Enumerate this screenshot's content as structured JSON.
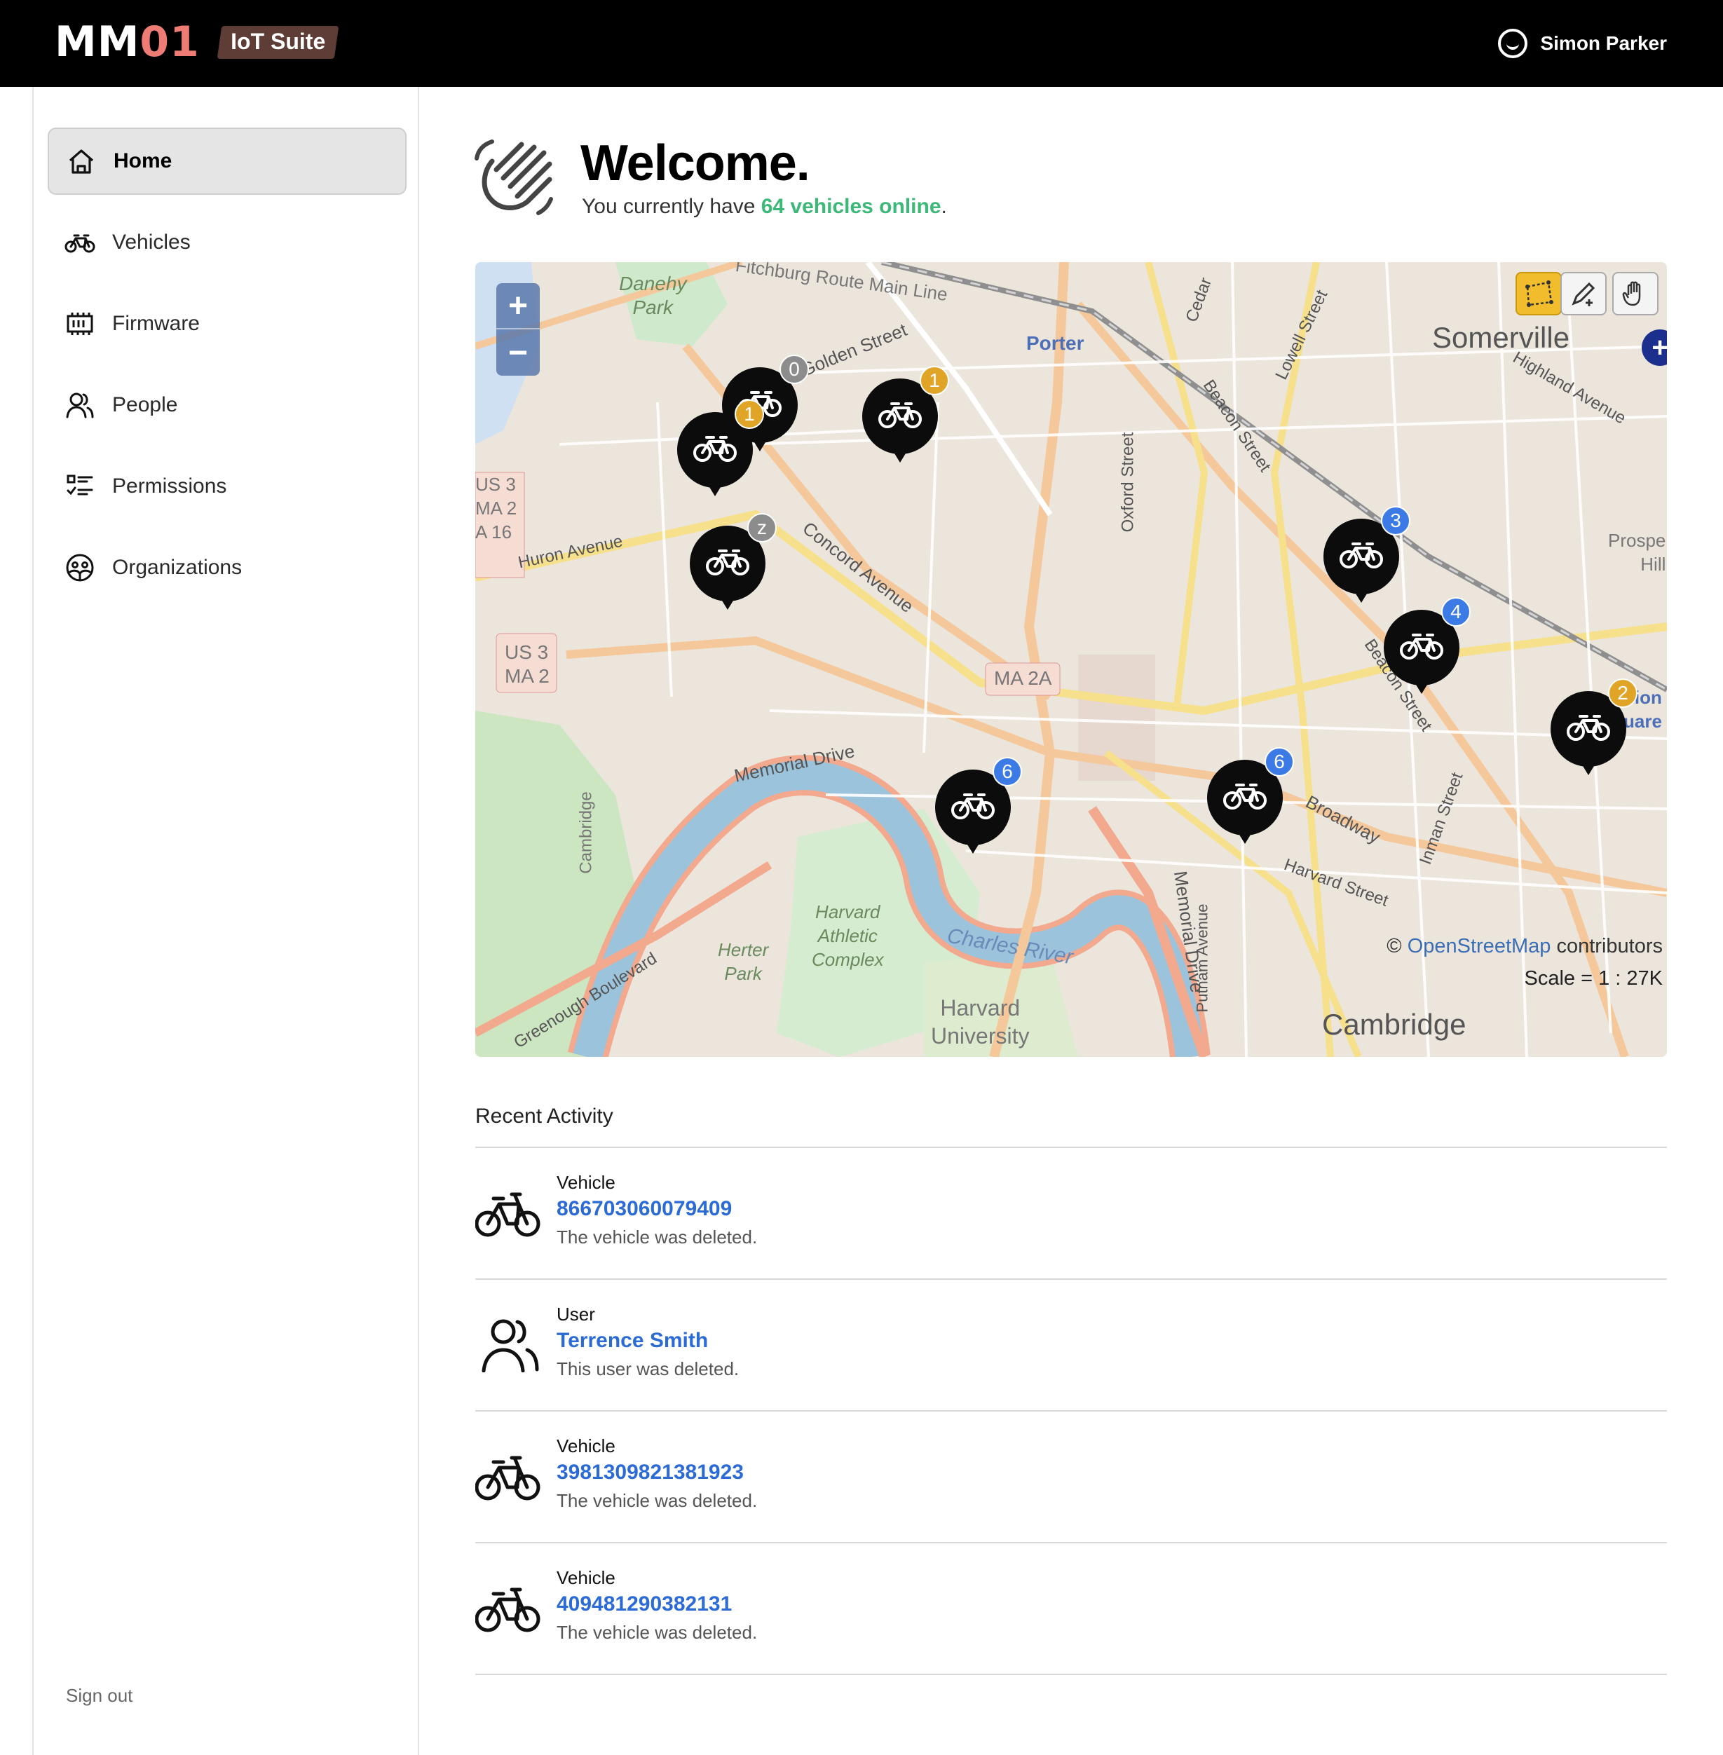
{
  "brand": {
    "mm": "MM",
    "num": "01",
    "tag": "IoT Suite"
  },
  "user": {
    "name": "Simon Parker"
  },
  "sidebar": {
    "items": [
      {
        "label": "Home",
        "icon": "home-icon",
        "active": true
      },
      {
        "label": "Vehicles",
        "icon": "bike-icon"
      },
      {
        "label": "Firmware",
        "icon": "chip-icon"
      },
      {
        "label": "People",
        "icon": "people-icon"
      },
      {
        "label": "Permissions",
        "icon": "checklist-icon"
      },
      {
        "label": "Organizations",
        "icon": "organization-icon"
      }
    ],
    "signout": "Sign out"
  },
  "welcome": {
    "title": "Welcome.",
    "prefix": "You currently have ",
    "highlight": "64 vehicles online",
    "suffix": "."
  },
  "map": {
    "zoom_in": "+",
    "zoom_out": "−",
    "labels": {
      "danehy": "Danehy",
      "park": "Park",
      "route": "Fitchburg Route Main Line",
      "golden": "Golden Street",
      "porter": "Porter",
      "somerville": "Somerville",
      "highland": "Highland Avenue",
      "cedar": "Cedar",
      "lowell": "Lowell Street",
      "oxford": "Oxford Street",
      "beacon1": "Beacon Street",
      "beacon2": "Beacon Street",
      "huron": "Huron Avenue",
      "concord": "Concord Avenue",
      "us3a": "US 3",
      "ma2a": "MA 2",
      "ma16": "A 16",
      "us3b": "US 3",
      "ma2b": "MA 2",
      "ma2x": "MA 2A",
      "memorial": "Memorial Drive",
      "memorial2": "Memorial Drive",
      "broadway": "Broadway",
      "harvard": "Harvard Street",
      "inman": "Inman Street",
      "prospect": "Prospe",
      "hill": "Hill",
      "charles": "Charles River",
      "athletic1": "Harvard",
      "athletic2": "Athletic",
      "athletic3": "Complex",
      "herter1": "Herter",
      "herter2": "Park",
      "harvu1": "Harvard",
      "harvu2": "University",
      "cambridge": "Cambridge",
      "putnam": "Putnam Avenue",
      "greenough": "Greenough Boulevard",
      "cambridgevert": "Cambridge",
      "union": "nion",
      "square": "uare"
    },
    "attribution_prefix": "© ",
    "attribution_link": "OpenStreetMap",
    "attribution_suffix": " contributors",
    "scale": "Scale = 1 : 27K",
    "markers": [
      {
        "badge": "0",
        "badge_color": "#8c8c8c"
      },
      {
        "badge": "1",
        "badge_color": "#e0a526"
      },
      {
        "badge": "1",
        "badge_color": "#e0a526"
      },
      {
        "badge": "z",
        "badge_color": "#8c8c8c"
      },
      {
        "badge": "3",
        "badge_color": "#3c7be6"
      },
      {
        "badge": "4",
        "badge_color": "#3c7be6"
      },
      {
        "badge": "2",
        "badge_color": "#e0a526"
      },
      {
        "badge": "6",
        "badge_color": "#3c7be6"
      },
      {
        "badge": "6",
        "badge_color": "#3c7be6"
      }
    ],
    "tools": [
      "polygon-select-icon",
      "edit-icon",
      "hand-pan-icon"
    ]
  },
  "recent_activity": {
    "title": "Recent Activity",
    "items": [
      {
        "type": "Vehicle",
        "link": "866703060079409",
        "desc": "The vehicle was deleted.",
        "icon": "bike-icon"
      },
      {
        "type": "User",
        "link": "Terrence Smith",
        "desc": "This user was deleted.",
        "icon": "people-icon"
      },
      {
        "type": "Vehicle",
        "link": "3981309821381923",
        "desc": "The vehicle was deleted.",
        "icon": "bike-icon"
      },
      {
        "type": "Vehicle",
        "link": "409481290382131",
        "desc": "The vehicle was deleted.",
        "icon": "bike-icon"
      }
    ]
  },
  "colors": {
    "accent_green": "#3cb878",
    "link_blue": "#2c6bd6",
    "brand_red": "#ee7c74",
    "badge_orange": "#e0a526",
    "badge_blue": "#3c7be6"
  }
}
